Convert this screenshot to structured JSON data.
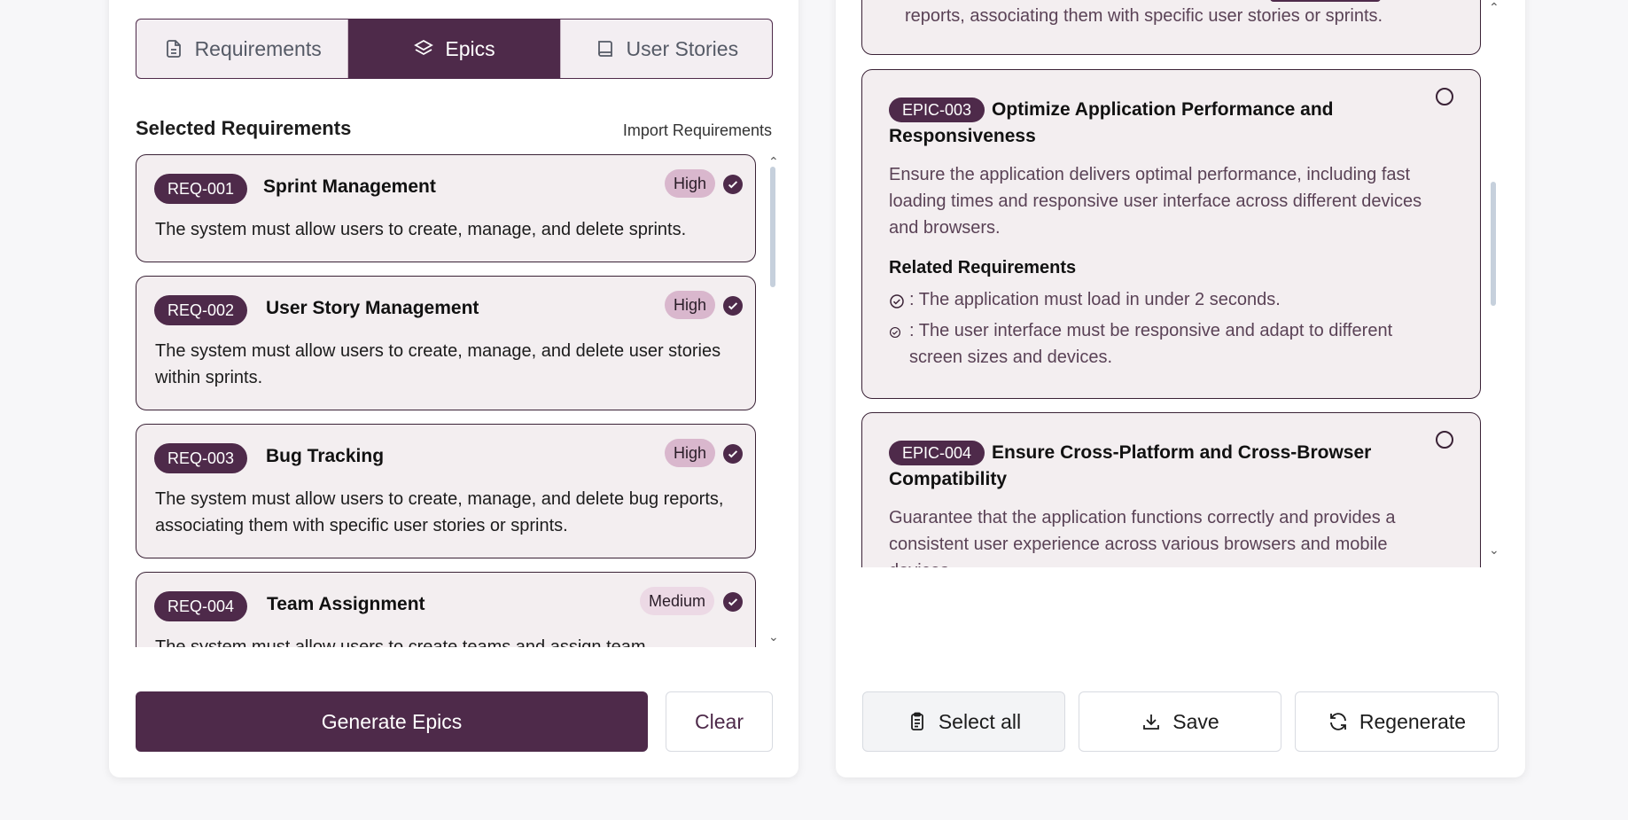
{
  "tabs": [
    {
      "label": "Requirements",
      "icon": "document-icon",
      "active": false
    },
    {
      "label": "Epics",
      "icon": "layers-icon",
      "active": true
    },
    {
      "label": "User Stories",
      "icon": "book-icon",
      "active": false
    }
  ],
  "requirements_section": {
    "title": "Selected Requirements",
    "import_link": "Import Requirements"
  },
  "requirements": [
    {
      "id": "REQ-001",
      "title": "Sprint Management",
      "priority": "High",
      "selected": true,
      "description": "The system must allow users to create, manage, and delete sprints."
    },
    {
      "id": "REQ-002",
      "title": "User Story Management",
      "priority": "High",
      "selected": true,
      "description": "The system must allow users to create, manage, and delete user stories within sprints."
    },
    {
      "id": "REQ-003",
      "title": "Bug Tracking",
      "priority": "High",
      "selected": true,
      "description": "The system must allow users to create, manage, and delete bug reports, associating them with specific user stories or sprints."
    },
    {
      "id": "REQ-004",
      "title": "Team Assignment",
      "priority": "Medium",
      "selected": true,
      "description": "The system must allow users to create teams and assign team"
    }
  ],
  "left_actions": {
    "generate_label": "Generate Epics",
    "clear_label": "Clear"
  },
  "epics_partial_top": {
    "description_tail": "reports, associating them with specific user stories or sprints."
  },
  "epics": [
    {
      "id": "EPIC-003",
      "title": "Optimize Application Performance and Responsiveness",
      "selected": false,
      "description": "Ensure the application delivers optimal performance, including fast loading times and responsive user interface across different devices and browsers.",
      "related_title": "Related Requirements",
      "related": [
        ": The application must load in under 2 seconds.",
        ": The user interface must be responsive and adapt to different screen sizes and devices."
      ]
    },
    {
      "id": "EPIC-004",
      "title": "Ensure Cross-Platform and Cross-Browser Compatibility",
      "selected": false,
      "description": "Guarantee that the application functions correctly and provides a consistent user experience across various browsers and mobile devices."
    }
  ],
  "right_actions": {
    "select_all_label": "Select all",
    "save_label": "Save",
    "regenerate_label": "Regenerate"
  },
  "colors": {
    "brand": "#4e2a4a",
    "card_bg": "#f3eef0",
    "priority_high": "#d9b7cd",
    "priority_medium": "#ecd9e5"
  }
}
